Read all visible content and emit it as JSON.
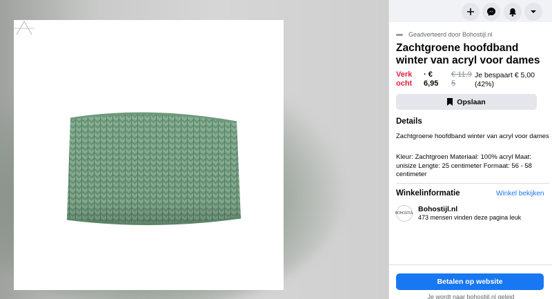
{
  "header": {
    "icons": [
      "plus-icon",
      "messenger-icon",
      "bell-icon",
      "caret-down-icon"
    ]
  },
  "image": {
    "alt": "",
    "product_color": "#7fa88c",
    "product_shadow": "#5d8a6b"
  },
  "ad": {
    "sponsor_label": "Geadverteerd door Bohostijl.nl",
    "title": "Zachtgroene hoofdband winter van acryl voor dames",
    "status": "Verkocht",
    "price": "· € 6,95",
    "old_price": "€ 11,95",
    "savings": "Je bespaart € 5,00 (42%)",
    "save_button": "Opslaan"
  },
  "details": {
    "heading": "Details",
    "line1": "Zachtgroene hoofdband winter van acryl voor dames",
    "line2": "Kleur: Zachtgroen Materiaal: 100% acryl Maat: unisize Lengte: 25 centimeter Formaat: 56 - 58 centimeter"
  },
  "shop": {
    "heading": "Winkelinformatie",
    "view_link": "Winkel bekijken",
    "logo_text": "BOHOSTIJL",
    "name": "Bohostijl.nl",
    "likes": "473 mensen vinden deze pagina leuk"
  },
  "footer": {
    "pay_button": "Betalen op website",
    "redirect_note": "Je wordt naar bohostijl.nl geleid"
  },
  "colors": {
    "accent": "#1877f2",
    "sold": "#e41e3f",
    "button_bg": "#e4e6eb"
  }
}
